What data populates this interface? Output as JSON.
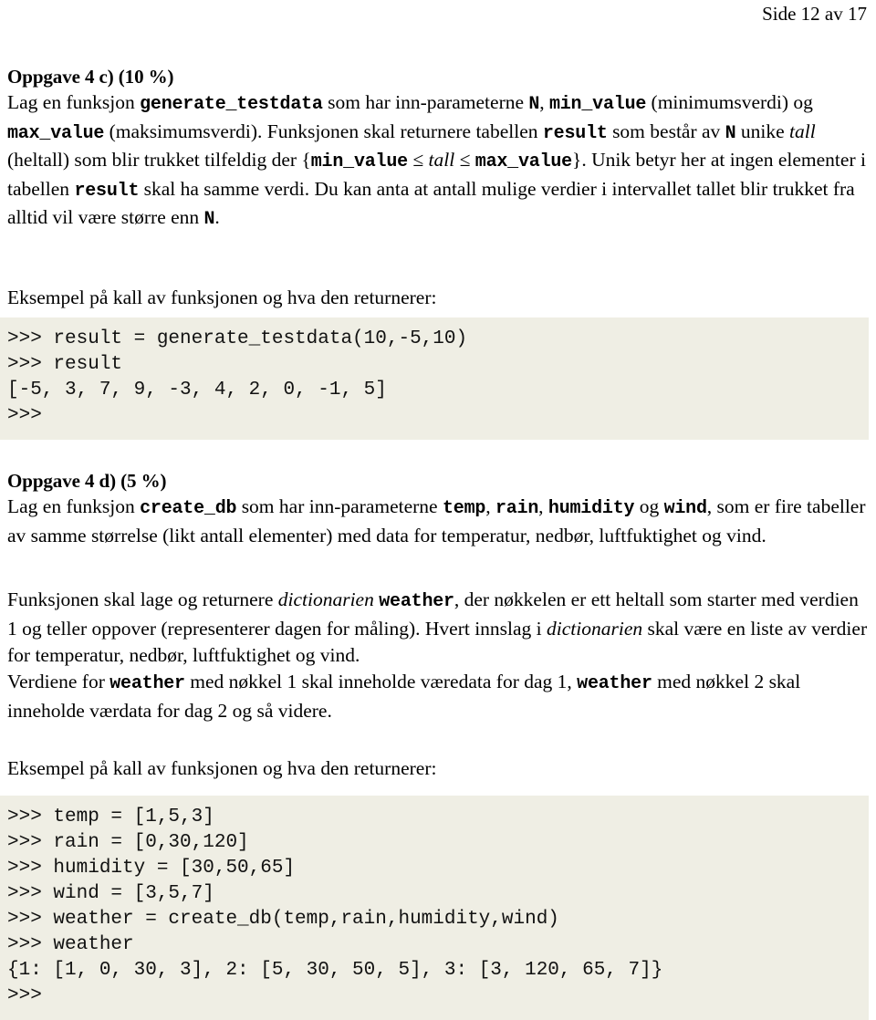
{
  "page_header": "Side 12 av 17",
  "task_c": {
    "heading": "Oppgave 4 c) (10 %)",
    "line1_a": "Lag en funksjon ",
    "line1_code1": "generate_testdata",
    "line1_b": " som har inn-parameterne ",
    "line1_code2": "N",
    "line1_c": ", ",
    "line1_code3": "min_value",
    "line2_a": " (minimumsverdi) og ",
    "line2_code1": "max_value",
    "line2_b": " (maksimumsverdi). Funksjonen skal returnere tabellen ",
    "line2_code2": "result",
    "line2_c": " som består av ",
    "line2_code3": "N",
    "line2_d": " unike ",
    "line2_ital": "tall",
    "line2_e": " (heltall) som blir trukket tilfeldig der ",
    "line3_brace_open": "{",
    "line3_code1": "min_value",
    "line3_le1": " ≤ ",
    "line3_ital": "tall",
    "line3_le2": " ≤ ",
    "line3_code2": "max_value",
    "line3_brace_close": "}",
    "line3_a": ". Unik betyr her at ingen elementer i tabellen ",
    "line3_code3": "result",
    "line3_b": " skal ha samme verdi. Du kan anta at antall mulige verdier i intervallet tallet blir trukket fra alltid vil være større enn ",
    "line3_code4": "N",
    "line3_c": "."
  },
  "example_label_c": "Eksempel på kall av funksjonen og hva den returnerer:",
  "code_c": ">>> result = generate_testdata(10,-5,10)\n>>> result\n[-5, 3, 7, 9, -3, 4, 2, 0, -1, 5]\n>>>",
  "task_d": {
    "heading": "Oppgave 4 d) (5 %)",
    "p1_a": "Lag en funksjon ",
    "p1_code1": "create_db",
    "p1_b": " som har inn-parameterne ",
    "p1_code2": "temp",
    "p1_c": ", ",
    "p1_code3": "rain",
    "p1_d": ", ",
    "p1_code4": "humidity",
    "p1_e": " og ",
    "p1_code5": "wind",
    "p1_f": ", som er fire tabeller av samme størrelse (likt antall elementer) med data for temperatur, nedbør, luftfuktighet og vind.",
    "p2_a": "Funksjonen skal lage og returnere ",
    "p2_ital1": "dictionarien",
    "p2_space1": " ",
    "p2_code1": "weather",
    "p2_b": ", der nøkkelen er ett heltall som starter med verdien 1 og teller oppover (representerer dagen for måling). Hvert innslag i ",
    "p2_ital2": "dictionarien",
    "p2_c": " skal være en liste av verdier for temperatur, nedbør, luftfuktighet og vind.",
    "p3_a": "Verdiene for ",
    "p3_code1": "weather",
    "p3_b": " med nøkkel 1 skal inneholde væredata for dag 1, ",
    "p3_code2": "weather",
    "p3_c": " med nøkkel 2 skal inneholde værdata for dag 2 og så videre."
  },
  "example_label_d": "Eksempel på kall av funksjonen og hva den returnerer:",
  "code_d": ">>> temp = [1,5,3]\n>>> rain = [0,30,120]\n>>> humidity = [30,50,65]\n>>> wind = [3,5,7]\n>>> weather = create_db(temp,rain,humidity,wind)\n>>> weather\n{1: [1, 0, 30, 3], 2: [5, 30, 50, 5], 3: [3, 120, 65, 7]}\n>>>",
  "colors": {
    "code_background": "#efeee4",
    "text": "#000000",
    "page_background": "#ffffff"
  }
}
